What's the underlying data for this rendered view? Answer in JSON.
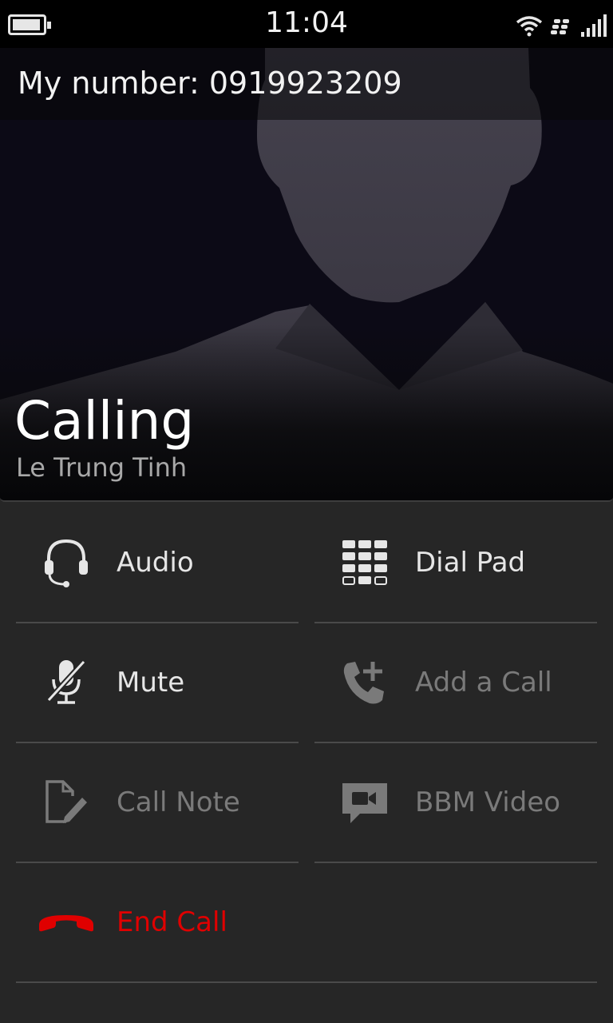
{
  "status_bar": {
    "time": "11:04",
    "icons": [
      "battery-icon",
      "wifi-icon",
      "blackberry-icon",
      "signal-icon"
    ]
  },
  "header": {
    "my_number": "My number: 0919923209",
    "call_status": "Calling",
    "contact_name": "Le Trung Tinh"
  },
  "actions": {
    "audio": {
      "label": "Audio",
      "icon": "headset-icon",
      "enabled": true
    },
    "dial_pad": {
      "label": "Dial Pad",
      "icon": "dialpad-icon",
      "enabled": true
    },
    "mute": {
      "label": "Mute",
      "icon": "mute-microphone-icon",
      "enabled": true
    },
    "add_call": {
      "label": "Add a Call",
      "icon": "add-call-icon",
      "enabled": false
    },
    "call_note": {
      "label": "Call Note",
      "icon": "note-edit-icon",
      "enabled": false
    },
    "bbm_video": {
      "label": "BBM Video",
      "icon": "video-chat-icon",
      "enabled": false
    },
    "end_call": {
      "label": "End Call",
      "icon": "hang-up-icon",
      "color": "#e00000"
    }
  },
  "colors": {
    "background": "#262626",
    "end_call_red": "#e00000",
    "disabled_text": "#7a7a7a"
  }
}
